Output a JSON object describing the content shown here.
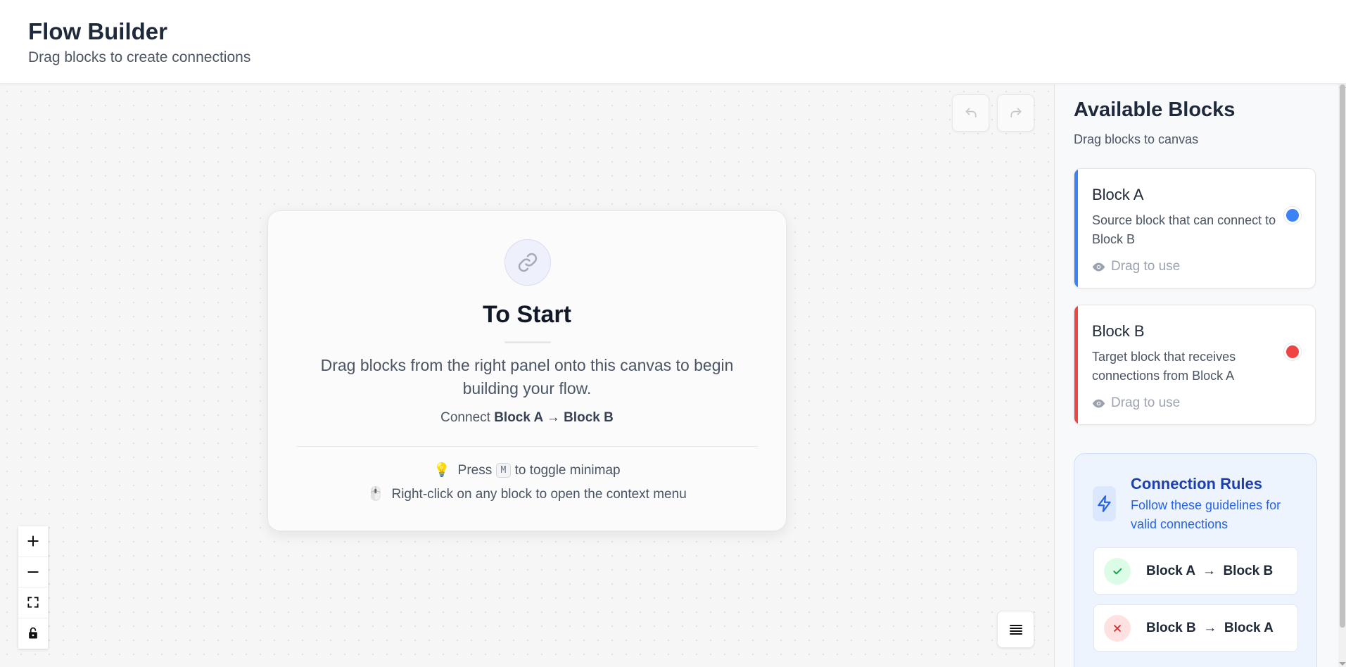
{
  "header": {
    "title": "Flow Builder",
    "subtitle": "Drag blocks to create connections"
  },
  "toolbar": {
    "undo_icon": "undo-icon",
    "redo_icon": "redo-icon"
  },
  "start_card": {
    "icon": "link-icon",
    "heading": "To Start",
    "description": "Drag blocks from the right panel onto this canvas to begin building your flow.",
    "connect_prefix": "Connect",
    "connect_rule": "Block A → Block B",
    "tip1_icon": "💡",
    "tip1_prefix": "Press",
    "tip1_key": "M",
    "tip1_suffix": "to toggle minimap",
    "tip2_icon": "🖱️",
    "tip2_text": "Right-click on any block to open the context menu"
  },
  "zoom_controls": [
    "zoom-in-icon",
    "zoom-out-icon",
    "fit-view-icon",
    "lock-icon"
  ],
  "minimap_toggle_icon": "list-icon",
  "sidebar": {
    "title": "Available Blocks",
    "subtitle": "Drag blocks to canvas",
    "blocks": [
      {
        "name": "Block A",
        "description": "Source block that can connect to Block B",
        "hint": "Drag to use",
        "color": "#3b82f6"
      },
      {
        "name": "Block B",
        "description": "Target block that receives connections from Block A",
        "hint": "Drag to use",
        "color": "#ef4444"
      }
    ],
    "rules": {
      "title": "Connection Rules",
      "subtitle": "Follow these guidelines for valid connections",
      "items": [
        {
          "text": "Block A  →  Block B",
          "valid": true
        },
        {
          "text": "Block B  →  Block A",
          "valid": false
        }
      ]
    }
  },
  "colors": {
    "accent_blue": "#3b82f6",
    "accent_red": "#ef4444",
    "rules_title": "#1e40af",
    "rules_text": "#2563eb",
    "valid_green": "#16a34a",
    "invalid_red": "#dc2626"
  }
}
